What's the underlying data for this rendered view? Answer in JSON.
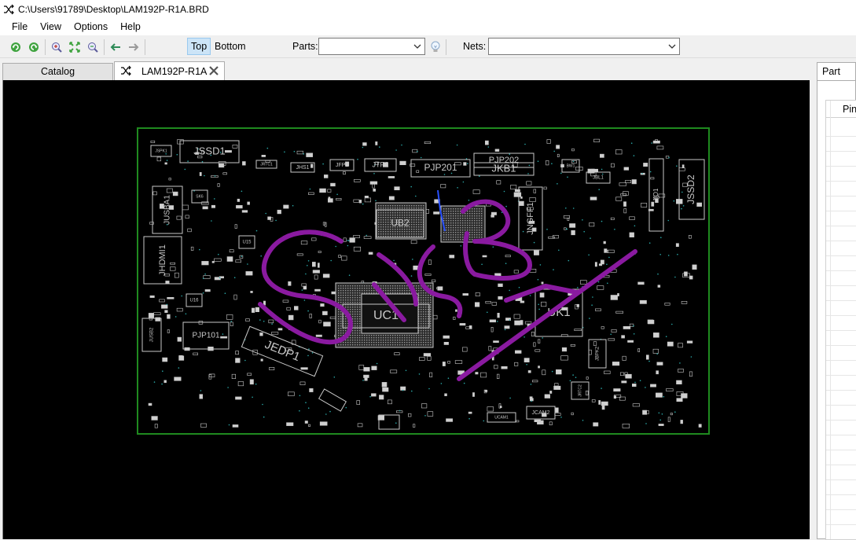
{
  "window": {
    "title": "C:\\Users\\91789\\Desktop\\LAM192P-R1A.BRD",
    "icon": "shuffle-icon"
  },
  "menu": {
    "items": [
      "File",
      "View",
      "Options",
      "Help"
    ]
  },
  "toolbar": {
    "icons": [
      "refresh-green-icon",
      "refresh-green-icon",
      "zoom-in-icon",
      "zoom-fit-icon",
      "zoom-out-icon",
      "arrow-left-icon",
      "arrow-right-icon"
    ],
    "layer_top": "Top",
    "layer_bottom": "Bottom",
    "active_layer": "Top",
    "parts_label": "Parts:",
    "parts_value": "",
    "nets_label": "Nets:",
    "nets_value": "",
    "bulb_icon": "lightbulb-icon"
  },
  "tabs": {
    "catalog": "Catalog",
    "board": "LAM192P-R1A",
    "close_icon": "close-icon"
  },
  "right_panel": {
    "tab": "Part",
    "column_header": "Pin"
  },
  "board": {
    "outline_color": "#1f8a1f",
    "silkscreen_color": "#c8c8c8",
    "annotation_color": "#8a1aa0",
    "labels": [
      "JSPK1",
      "JSSD1",
      "JRTC1",
      "JHS1",
      "JFP1",
      "JTP1",
      "PJP201",
      "PJP202",
      "JKB1",
      "BW1",
      "JBL1",
      "JIO1",
      "JSSD2",
      "JUSBA1",
      "SK6",
      "UB2",
      "JNGFF1",
      "JHDMI1",
      "U15",
      "U16",
      "UC1",
      "UK1",
      "JUSB2",
      "PJP101",
      "JEDP1",
      "JBPK2",
      "JRTC2",
      "JCAM2",
      "UCAM1"
    ]
  }
}
